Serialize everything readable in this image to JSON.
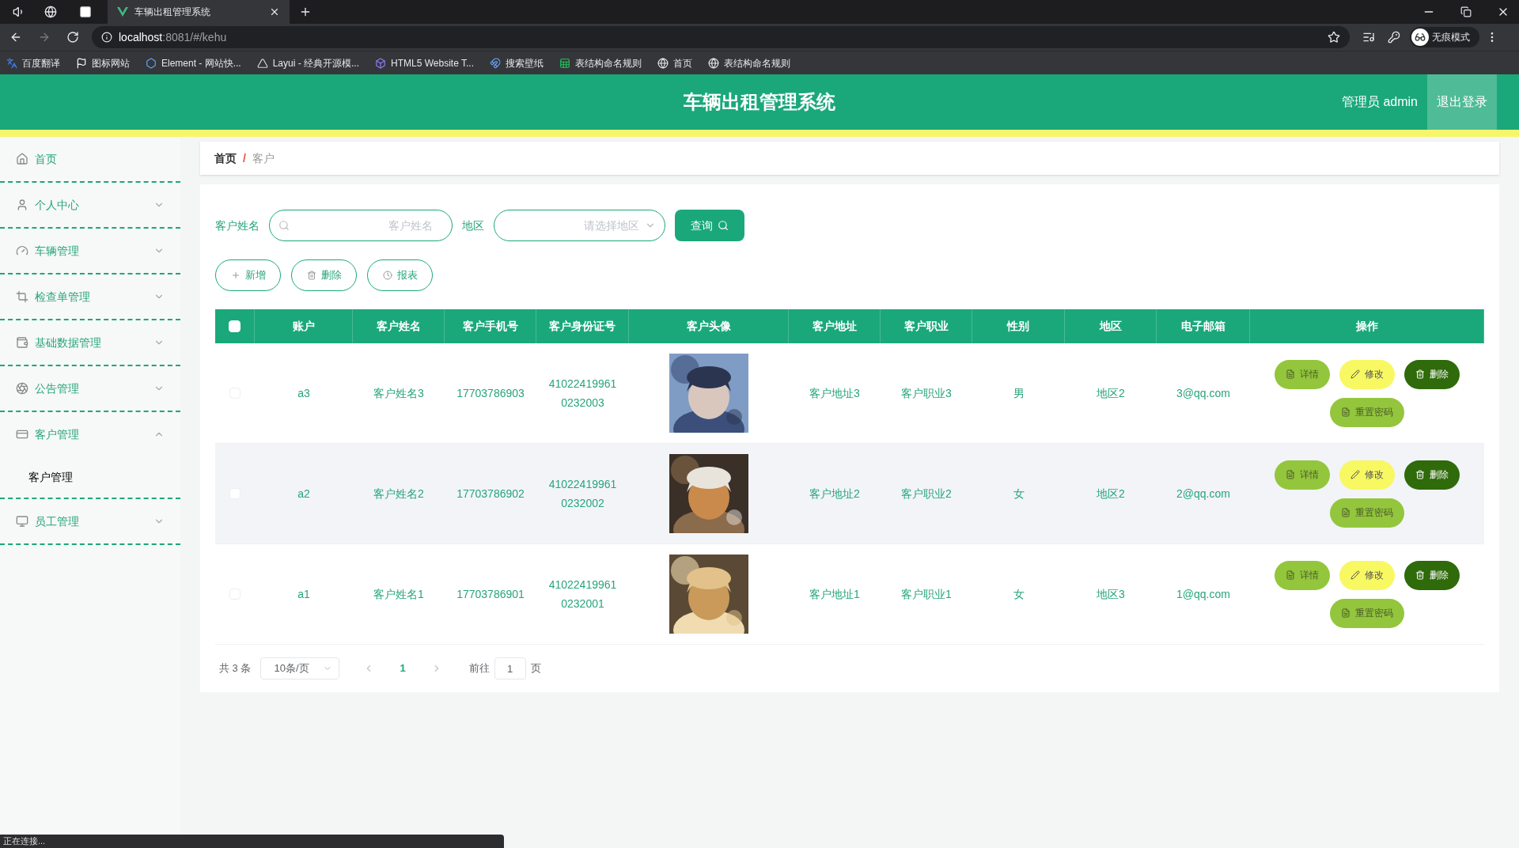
{
  "browser": {
    "tabs": [
      {
        "title": "车辆出租管理系统",
        "selected": true
      }
    ],
    "address": {
      "host": "localhost",
      "path": ":8081/#/kehu"
    },
    "bookmarks": [
      {
        "label": "百度翻译"
      },
      {
        "label": "图标网站"
      },
      {
        "label": "Element - 网站快..."
      },
      {
        "label": "Layui - 经典开源模..."
      },
      {
        "label": "HTML5 Website T..."
      },
      {
        "label": "搜索壁纸"
      },
      {
        "label": "表结构命名规则"
      },
      {
        "label": "首页"
      },
      {
        "label": "表结构命名规则"
      }
    ],
    "profile": "无痕模式"
  },
  "header": {
    "title": "车辆出租管理系统",
    "user": "管理员 admin",
    "logout": "退出登录"
  },
  "sidebar": {
    "items": [
      {
        "label": "首页",
        "kind": "link"
      },
      {
        "label": "个人中心",
        "kind": "menu",
        "expanded": false
      },
      {
        "label": "车辆管理",
        "kind": "menu",
        "expanded": false
      },
      {
        "label": "检查单管理",
        "kind": "menu",
        "expanded": false
      },
      {
        "label": "基础数据管理",
        "kind": "menu",
        "expanded": false
      },
      {
        "label": "公告管理",
        "kind": "menu",
        "expanded": false
      },
      {
        "label": "客户管理",
        "kind": "menu",
        "expanded": true,
        "children": [
          {
            "label": "客户管理",
            "selected": true
          }
        ]
      },
      {
        "label": "员工管理",
        "kind": "menu",
        "expanded": false
      }
    ]
  },
  "breadcrumb": {
    "separator": "/",
    "items": [
      {
        "label": "首页",
        "selected": false
      },
      {
        "label": "客户",
        "selected": true
      }
    ]
  },
  "filters": [
    {
      "label": "客户姓名",
      "placeholder": "客户姓名",
      "kind": "text"
    },
    {
      "label": "地区",
      "placeholder": "请选择地区",
      "kind": "select"
    }
  ],
  "search_button": "查询",
  "actions": [
    {
      "label": "新增"
    },
    {
      "label": "删除"
    },
    {
      "label": "报表"
    }
  ],
  "table": {
    "all_checked": false,
    "columns": [
      "账户",
      "客户姓名",
      "客户手机号",
      "客户身份证号",
      "客户头像",
      "客户地址",
      "客户职业",
      "性别",
      "地区",
      "电子邮箱",
      "操作"
    ],
    "rows": [
      {
        "checked": false,
        "account": "a3",
        "name": "客户姓名3",
        "phone": "17703786903",
        "id_number": "410224199610232003",
        "address": "客户地址3",
        "job": "客户职业3",
        "gender": "男",
        "region": "地区2",
        "email": "3@qq.com",
        "ops": [
          {
            "label": "详情",
            "kind": "detail"
          },
          {
            "label": "修改",
            "kind": "edit"
          },
          {
            "label": "删除",
            "kind": "delete"
          },
          {
            "label": "重置密码",
            "kind": "reset"
          }
        ]
      },
      {
        "checked": false,
        "account": "a2",
        "name": "客户姓名2",
        "phone": "17703786902",
        "id_number": "410224199610232002",
        "address": "客户地址2",
        "job": "客户职业2",
        "gender": "女",
        "region": "地区2",
        "email": "2@qq.com",
        "ops": [
          {
            "label": "详情",
            "kind": "detail"
          },
          {
            "label": "修改",
            "kind": "edit"
          },
          {
            "label": "删除",
            "kind": "delete"
          },
          {
            "label": "重置密码",
            "kind": "reset"
          }
        ]
      },
      {
        "checked": false,
        "account": "a1",
        "name": "客户姓名1",
        "phone": "17703786901",
        "id_number": "410224199610232001",
        "address": "客户地址1",
        "job": "客户职业1",
        "gender": "女",
        "region": "地区3",
        "email": "1@qq.com",
        "ops": [
          {
            "label": "详情",
            "kind": "detail"
          },
          {
            "label": "修改",
            "kind": "edit"
          },
          {
            "label": "删除",
            "kind": "delete"
          },
          {
            "label": "重置密码",
            "kind": "reset"
          }
        ]
      }
    ]
  },
  "pagination": {
    "total": "共 3 条",
    "page_size": "10条/页",
    "pages": [
      {
        "label": "1",
        "selected": true
      }
    ],
    "goto_label": "前往",
    "goto_value": "1",
    "goto_suffix": "页"
  },
  "status_bar": "正在连接..."
}
